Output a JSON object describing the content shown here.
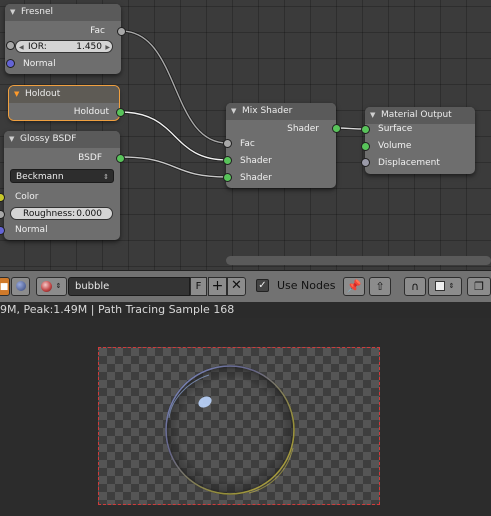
{
  "nodes": {
    "fresnel": {
      "title": "Fresnel",
      "output_fac": "Fac",
      "ior_label": "IOR:",
      "ior_value": "1.450",
      "input_normal": "Normal"
    },
    "holdout": {
      "title": "Holdout",
      "output_holdout": "Holdout"
    },
    "glossy": {
      "title": "Glossy BSDF",
      "output_bsdf": "BSDF",
      "distribution": "Beckmann",
      "input_color": "Color",
      "roughness_label": "Roughness:",
      "roughness_value": "0.000",
      "input_normal": "Normal"
    },
    "mix_shader": {
      "title": "Mix Shader",
      "output_shader": "Shader",
      "input_fac": "Fac",
      "input_shader_1": "Shader",
      "input_shader_2": "Shader"
    },
    "material_output": {
      "title": "Material Output",
      "input_surface": "Surface",
      "input_volume": "Volume",
      "input_displacement": "Displacement"
    }
  },
  "header": {
    "material_name": "bubble",
    "fake_user_label": "F",
    "new_icon": "plus-icon",
    "unlink_icon": "close-icon",
    "use_nodes_label": "Use Nodes",
    "use_nodes_checked": "✓"
  },
  "status": {
    "text": "9M, Peak:1.49M | Path Tracing Sample 168"
  },
  "colors": {
    "shader_socket": "#58c35a",
    "float_socket": "#a8a8a8",
    "vector_socket": "#6464d6",
    "color_socket": "#c8c82a",
    "selected_outline": "#f0a040",
    "render_border": "#d23a3a"
  }
}
